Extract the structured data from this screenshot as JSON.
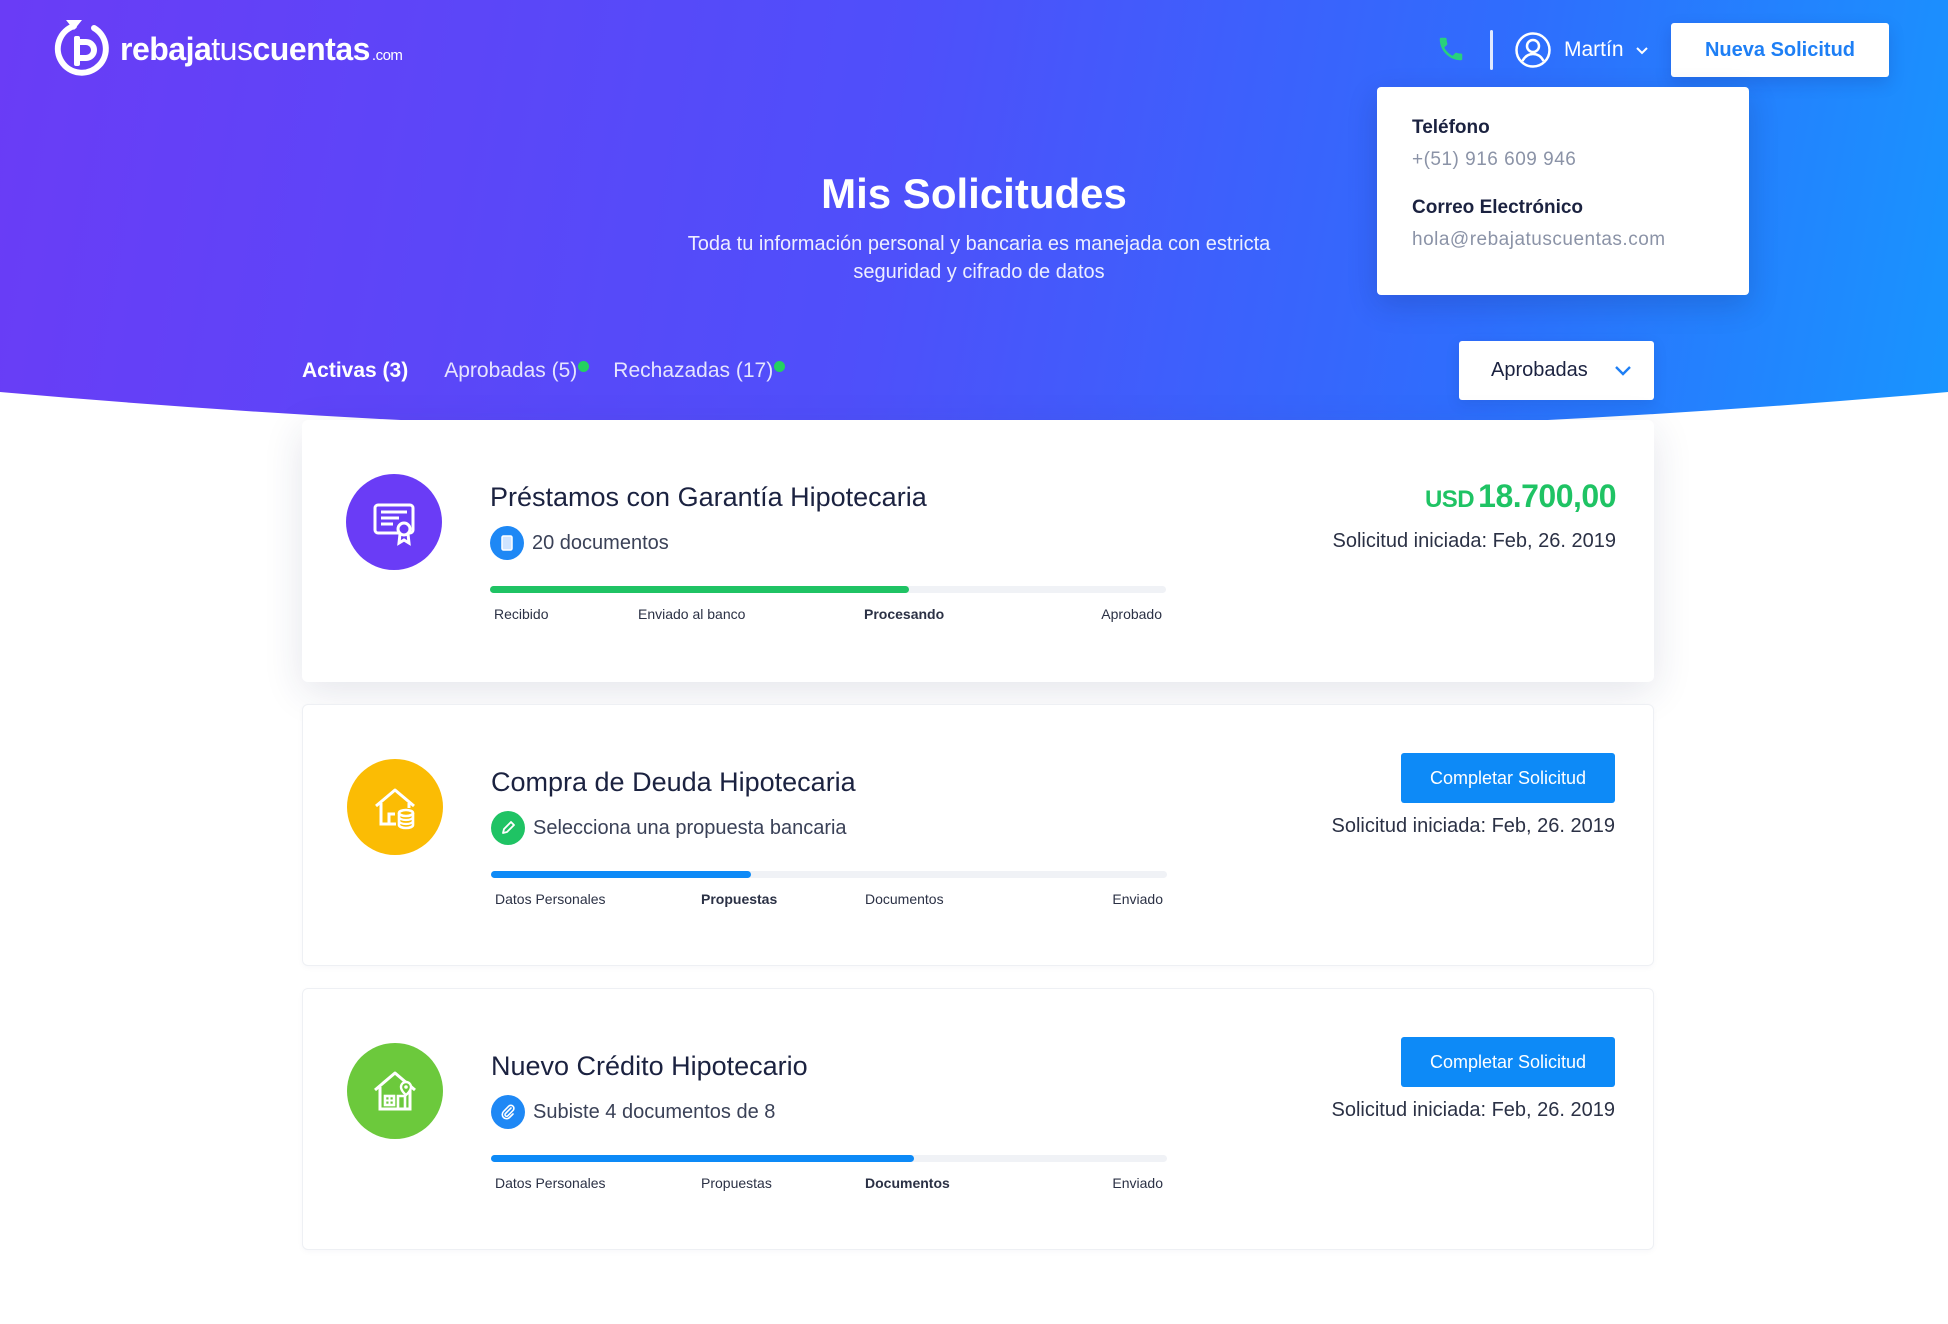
{
  "brand": {
    "name_bold_1": "rebaja",
    "name_thin": "tus",
    "name_bold_2": "cuentas",
    "domain_suffix": ".com"
  },
  "header": {
    "phone_icon": "phone-icon",
    "user_icon": "user-circle-icon",
    "user_name": "Martín",
    "new_request_label": "Nueva Solicitud"
  },
  "contact": {
    "phone_label": "Teléfono",
    "phone_value": "+(51) 916 609 946",
    "email_label": "Correo Electrónico",
    "email_value": "hola@rebajatuscuentas.com"
  },
  "hero": {
    "title": "Mis Solicitudes",
    "subtitle": "Toda tu información personal y bancaria es manejada con estricta seguridad y cifrado de datos"
  },
  "tabs": [
    {
      "label": "Activas (3)",
      "active": true,
      "dot": false
    },
    {
      "label": "Aprobadas (5)",
      "active": false,
      "dot": true
    },
    {
      "label": "Rechazadas (17)",
      "active": false,
      "dot": true
    }
  ],
  "filter": {
    "selected": "Aprobadas"
  },
  "colors": {
    "accent_blue": "#0d8af7",
    "success_green": "#1fc364",
    "dot_green": "#23d160",
    "avatar_purple": "#6a3cf6",
    "avatar_yellow": "#fbbc04",
    "avatar_green": "#6cc93c"
  },
  "requests": [
    {
      "title": "Préstamos con Garantía Hipotecaria",
      "icon": "certificate-icon",
      "sub_icon": "document-icon",
      "sub_text": "20 documentos",
      "amount_currency": "USD",
      "amount_value": "18.700,00",
      "action_label": "",
      "date_text": "Solicitud iniciada: Feb, 26. 2019",
      "progress": 0.62,
      "steps": [
        "Recibido",
        "Enviado al banco",
        "Procesando",
        "Aprobado"
      ],
      "current_step": 2
    },
    {
      "title": "Compra de Deuda Hipotecaria",
      "icon": "house-coins-icon",
      "sub_icon": "pencil-icon",
      "sub_text": "Selecciona una propuesta bancaria",
      "amount_currency": "",
      "amount_value": "",
      "action_label": "Completar Solicitud",
      "date_text": "Solicitud iniciada: Feb, 26. 2019",
      "progress": 0.385,
      "steps": [
        "Datos Personales",
        "Propuestas",
        "Documentos",
        "Enviado"
      ],
      "current_step": 1
    },
    {
      "title": "Nuevo Crédito Hipotecario",
      "icon": "house-location-icon",
      "sub_icon": "paperclip-icon",
      "sub_text": "Subiste 4 documentos de 8",
      "amount_currency": "",
      "amount_value": "",
      "action_label": "Completar Solicitud",
      "date_text": "Solicitud iniciada: Feb, 26. 2019",
      "progress": 0.625,
      "steps": [
        "Datos Personales",
        "Propuestas",
        "Documentos",
        "Enviado"
      ],
      "current_step": 2
    }
  ]
}
